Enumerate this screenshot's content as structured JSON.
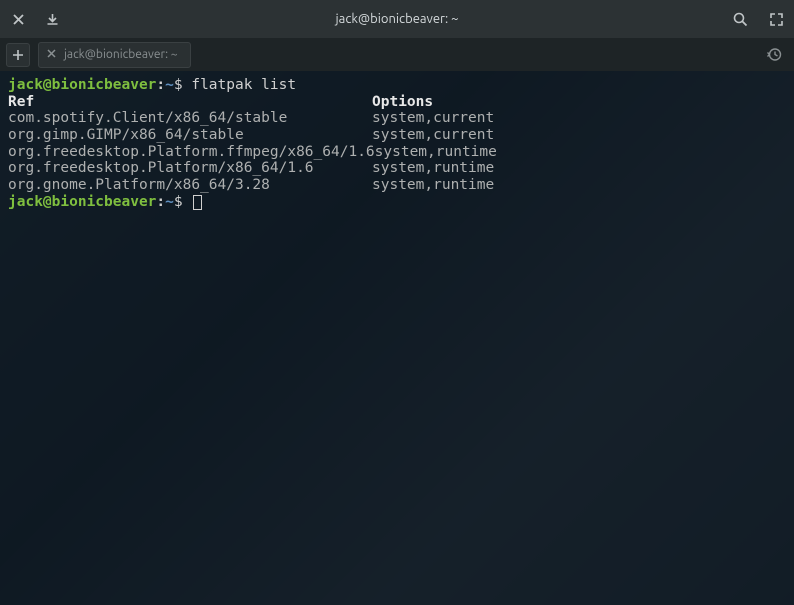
{
  "titlebar": {
    "title": "jack@bionicbeaver: ~"
  },
  "tab": {
    "label": "jack@bionicbeaver: ~"
  },
  "prompt": {
    "user_host": "jack@bionicbeaver",
    "sep": ":",
    "path": "~",
    "dollar": "$"
  },
  "command": "flatpak list",
  "headers": {
    "ref": "Ref",
    "options": "Options"
  },
  "rows": [
    {
      "ref": "com.spotify.Client/x86_64/stable",
      "options": "system,current"
    },
    {
      "ref": "org.gimp.GIMP/x86_64/stable",
      "options": "system,current"
    },
    {
      "ref": "org.freedesktop.Platform.ffmpeg/x86_64/1.6",
      "options": "system,runtime"
    },
    {
      "ref": "org.freedesktop.Platform/x86_64/1.6",
      "options": "system,runtime"
    },
    {
      "ref": "org.gnome.Platform/x86_64/3.28",
      "options": "system,runtime"
    }
  ]
}
